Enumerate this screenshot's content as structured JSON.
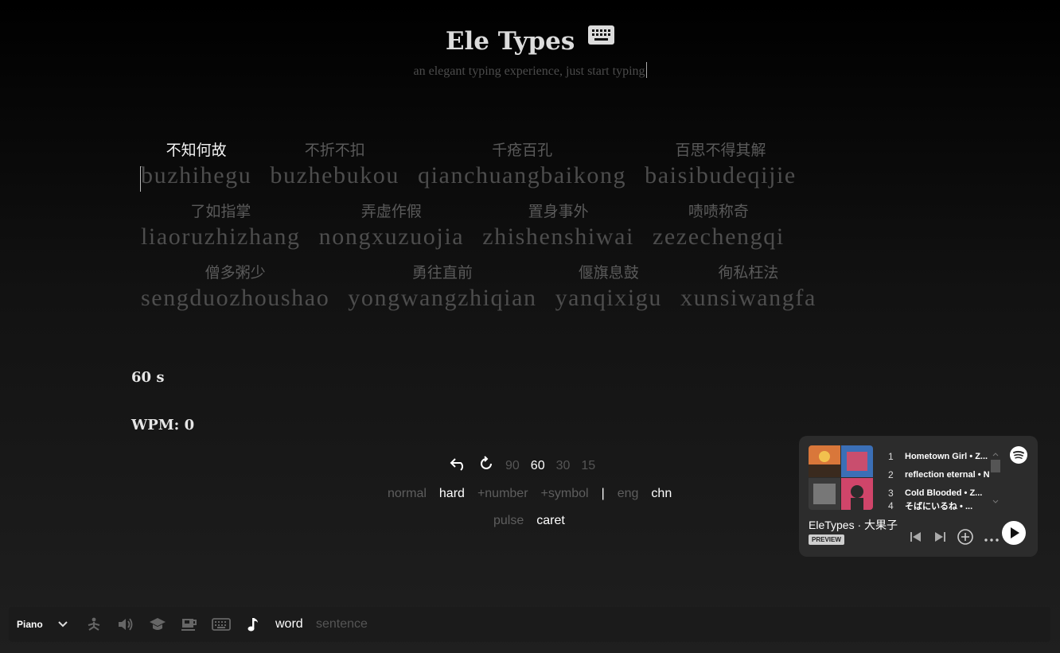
{
  "header": {
    "title": "Ele Types",
    "subtitle": "an elegant typing experience, just start typing"
  },
  "words": [
    [
      {
        "zh": "不知何故",
        "py": "buzhihegu",
        "active": true
      },
      {
        "zh": "不折不扣",
        "py": "buzhebukou"
      },
      {
        "zh": "千疮百孔",
        "py": "qianchuangbaikong"
      },
      {
        "zh": "百思不得其解",
        "py": "baisibudeqijie"
      }
    ],
    [
      {
        "zh": "了如指掌",
        "py": "liaoruzhizhang"
      },
      {
        "zh": "弄虚作假",
        "py": "nongxuzuojia"
      },
      {
        "zh": "置身事外",
        "py": "zhishenshiwai"
      },
      {
        "zh": "啧啧称奇",
        "py": "zezechengqi"
      }
    ],
    [
      {
        "zh": "僧多粥少",
        "py": "sengduozhoushao"
      },
      {
        "zh": "勇往直前",
        "py": "yongwangzhiqian"
      },
      {
        "zh": "偃旗息鼓",
        "py": "yanqixigu"
      },
      {
        "zh": "徇私枉法",
        "py": "xunsiwangfa"
      }
    ]
  ],
  "stats": {
    "timer": "60 s",
    "wpm": "WPM: 0"
  },
  "time_options": {
    "items": [
      "90",
      "60",
      "30",
      "15"
    ],
    "selected": "60"
  },
  "difficulty": {
    "normal": "normal",
    "hard": "hard",
    "number": "+number",
    "symbol": "+symbol",
    "separator": "|",
    "eng": "eng",
    "chn": "chn"
  },
  "caret_style": {
    "pulse": "pulse",
    "caret": "caret"
  },
  "spotify": {
    "tracks": [
      {
        "num": "1",
        "title": "Hometown Girl • Z..."
      },
      {
        "num": "2",
        "title": "reflection eternal • N"
      },
      {
        "num": "3",
        "title": "Cold Blooded • Z..."
      },
      {
        "num": "4",
        "title": "そばにいるね • ..."
      }
    ],
    "playlist": "EleTypes",
    "owner": "· 大果子",
    "preview": "PREVIEW",
    "colors": {
      "bg": "#2c2c2c",
      "accent": "#ffffff"
    }
  },
  "bottom_bar": {
    "sound_label": "Piano",
    "word_mode": "word",
    "sentence_mode": "sentence",
    "icons": [
      "chevron-down-icon",
      "yoga-icon",
      "volume-icon",
      "graduation-cap-icon",
      "coffee-icon",
      "keyboard-icon",
      "music-note-icon"
    ]
  }
}
